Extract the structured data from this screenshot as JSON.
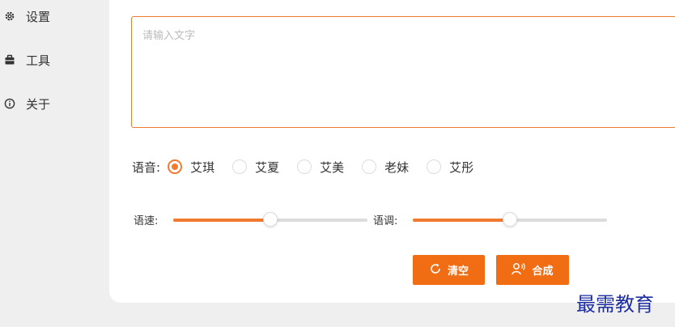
{
  "sidebar": {
    "items": [
      {
        "label": "设置",
        "icon": "gear-icon"
      },
      {
        "label": "工具",
        "icon": "toolbox-icon"
      },
      {
        "label": "关于",
        "icon": "info-icon"
      }
    ]
  },
  "editor": {
    "placeholder": "请输入文字",
    "value": ""
  },
  "voice": {
    "label": "语音:",
    "options": [
      "艾琪",
      "艾夏",
      "艾美",
      "老妹",
      "艾彤"
    ],
    "selected": "艾琪"
  },
  "speed": {
    "label": "语速:",
    "value_fraction": 0.5
  },
  "pitch": {
    "label": "语调:",
    "value_fraction": 0.5
  },
  "buttons": {
    "clear_label": "清空",
    "synthesize_label": "合成"
  },
  "watermark": "最需教育",
  "colors": {
    "accent": "#f07a2f",
    "button": "#f06d14",
    "watermark": "#1c2ea0"
  }
}
